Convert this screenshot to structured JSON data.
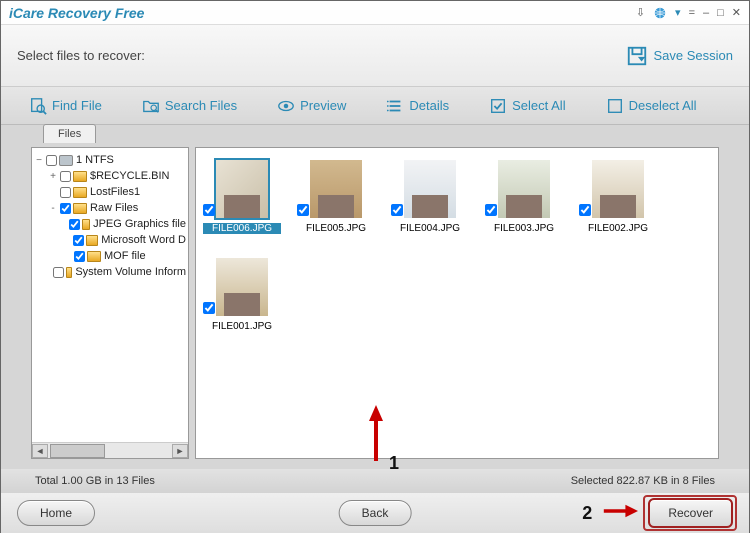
{
  "app": {
    "title": "iCare Recovery Free"
  },
  "header": {
    "label": "Select files to recover:",
    "save_session": "Save Session"
  },
  "toolbar": {
    "find": "Find File",
    "search": "Search Files",
    "preview": "Preview",
    "details": "Details",
    "select_all": "Select All",
    "deselect_all": "Deselect All"
  },
  "tabs": {
    "files": "Files"
  },
  "tree": {
    "root": "1 NTFS",
    "items": [
      {
        "label": "$RECYCLE.BIN",
        "checked": false,
        "indent": 1,
        "twisty": "+"
      },
      {
        "label": "LostFiles1",
        "checked": false,
        "indent": 1,
        "twisty": ""
      },
      {
        "label": "Raw Files",
        "checked": true,
        "indent": 1,
        "twisty": "-"
      },
      {
        "label": "JPEG Graphics file",
        "checked": true,
        "indent": 2,
        "twisty": ""
      },
      {
        "label": "Microsoft Word D",
        "checked": true,
        "indent": 2,
        "twisty": ""
      },
      {
        "label": "MOF file",
        "checked": true,
        "indent": 2,
        "twisty": ""
      },
      {
        "label": "System Volume Inform",
        "checked": false,
        "indent": 1,
        "twisty": ""
      }
    ]
  },
  "thumbs": [
    {
      "name": "FILE006.JPG",
      "checked": true,
      "selected": true,
      "cls": "a"
    },
    {
      "name": "FILE005.JPG",
      "checked": true,
      "selected": false,
      "cls": "b"
    },
    {
      "name": "FILE004.JPG",
      "checked": true,
      "selected": false,
      "cls": "c"
    },
    {
      "name": "FILE003.JPG",
      "checked": true,
      "selected": false,
      "cls": "d"
    },
    {
      "name": "FILE002.JPG",
      "checked": true,
      "selected": false,
      "cls": "e"
    },
    {
      "name": "FILE001.JPG",
      "checked": true,
      "selected": false,
      "cls": "f"
    }
  ],
  "status": {
    "left": "Total 1.00 GB in 13 Files",
    "right": "Selected 822.87 KB in 8 Files"
  },
  "footer": {
    "home": "Home",
    "back": "Back",
    "recover": "Recover"
  },
  "annotations": {
    "one": "1",
    "two": "2"
  }
}
